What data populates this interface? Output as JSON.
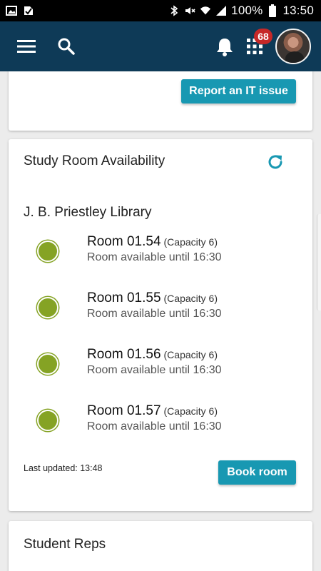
{
  "status_bar": {
    "left_icons": [
      "image-icon",
      "download-done-icon"
    ],
    "right_icons": [
      "bluetooth-icon",
      "mute-icon",
      "wifi-icon",
      "signal-icon",
      "battery-icon"
    ],
    "battery": "100%",
    "time": "13:50"
  },
  "app_bar": {
    "background": "#0e3a57",
    "notification_count": "68"
  },
  "top_card": {
    "report_label": "Report an IT issue"
  },
  "study": {
    "title": "Study Room Availability",
    "library": "J. B. Priestley Library",
    "rooms": [
      {
        "name": "Room 01.54",
        "capacity": "(Capacity 6)",
        "status": "Room available until 16:30"
      },
      {
        "name": "Room 01.55",
        "capacity": "(Capacity 6)",
        "status": "Room available until 16:30"
      },
      {
        "name": "Room 01.56",
        "capacity": "(Capacity 6)",
        "status": "Room available until 16:30"
      },
      {
        "name": "Room 01.57",
        "capacity": "(Capacity 6)",
        "status": "Room available until 16:30"
      }
    ],
    "last_updated": "Last updated: 13:48",
    "book_label": "Book room",
    "available_color": "#85a324",
    "accent": "#1898b2"
  },
  "reps": {
    "title": "Student Reps"
  }
}
